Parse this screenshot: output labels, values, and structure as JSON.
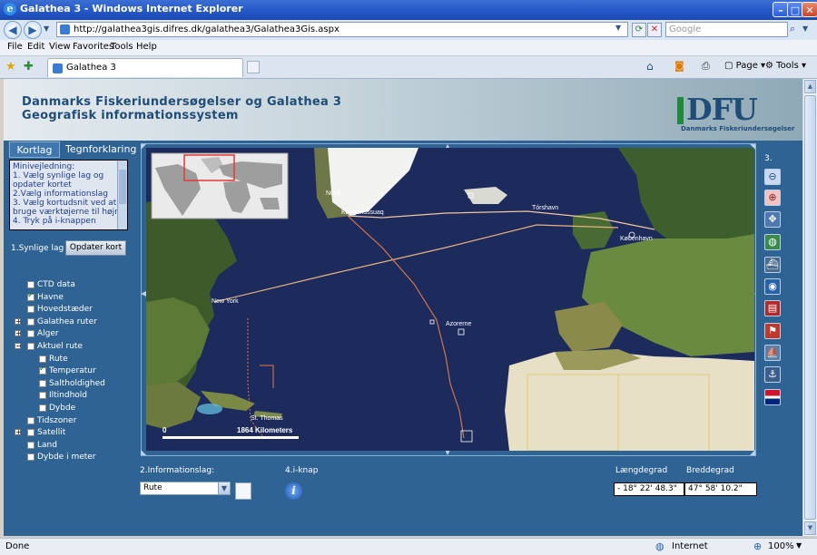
{
  "window": {
    "title": "Galathea 3 - Windows Internet Explorer",
    "controls": [
      "minimize-icon",
      "maximize-icon",
      "close-icon"
    ]
  },
  "address_bar": {
    "url": "http://galathea3gis.difres.dk/galathea3/Galathea3Gis.aspx",
    "search_placeholder": "Google"
  },
  "menu": [
    "File",
    "Edit",
    "View",
    "Favorites",
    "Tools",
    "Help"
  ],
  "tab": {
    "label": "Galathea 3"
  },
  "command_bar": {
    "page_label": "Page",
    "tools_label": "Tools"
  },
  "banner": {
    "line1": "Danmarks Fiskeriundersøgelser og Galathea 3",
    "line2": "Geografisk informationssystem",
    "logo_text": "DFU",
    "logo_sub": "Danmarks Fiskeriundersøgelser"
  },
  "panel": {
    "tabs": [
      "Kortlag",
      "Tegnforklaring"
    ],
    "help_lines": [
      "Minivejledning:",
      "1. Vælg synlige lag og",
      "opdater kortet",
      "2.Vælg informationslag",
      "3. Vælg kortudsnit ved at",
      "bruge værktøjerne til højre",
      "4. Tryk på i-knappen"
    ],
    "synlige_label": "1.Synlige lag",
    "update_button": "Opdater kort"
  },
  "layers": [
    {
      "label": "CTD data",
      "checked": false,
      "level": 0,
      "expander": ""
    },
    {
      "label": "Havne",
      "checked": true,
      "level": 0,
      "expander": ""
    },
    {
      "label": "Hovedstæder",
      "checked": false,
      "level": 0,
      "expander": ""
    },
    {
      "label": "Galathea ruter",
      "checked": false,
      "level": 0,
      "expander": "+"
    },
    {
      "label": "Alger",
      "checked": false,
      "level": 0,
      "expander": "+"
    },
    {
      "label": "Aktuel rute",
      "checked": false,
      "level": 0,
      "expander": "−"
    },
    {
      "label": "Rute",
      "checked": false,
      "level": 1,
      "expander": ""
    },
    {
      "label": "Temperatur",
      "checked": true,
      "level": 1,
      "expander": ""
    },
    {
      "label": "Saltholdighed",
      "checked": false,
      "level": 1,
      "expander": ""
    },
    {
      "label": "Iltindhold",
      "checked": false,
      "level": 1,
      "expander": ""
    },
    {
      "label": "Dybde",
      "checked": false,
      "level": 1,
      "expander": ""
    },
    {
      "label": "Tidszoner",
      "checked": false,
      "level": 0,
      "expander": ""
    },
    {
      "label": "Satellit",
      "checked": false,
      "level": 0,
      "expander": "+"
    },
    {
      "label": "Land",
      "checked": false,
      "level": 0,
      "expander": ""
    },
    {
      "label": "Dybde i meter",
      "checked": false,
      "level": 0,
      "expander": ""
    }
  ],
  "map": {
    "labels": {
      "nuuk": "Nuuk",
      "kangerlussuaq": "Kangerlussuaq",
      "torshavn": "Tórshavn",
      "kobenhavn": "København",
      "new_york": "New York",
      "azorerne": "Azorerne",
      "st_thomas": "St. Thomas"
    },
    "scale_zero": "0",
    "scale_label": "1864 Kilometers"
  },
  "toolbar": {
    "step_label": "3.",
    "tools": [
      "zoom-out-icon",
      "zoom-in-icon",
      "pan-icon",
      "full-extent-icon",
      "ship-icon",
      "globe-icon",
      "book-icon",
      "flag-icon",
      "boat-icon",
      "measure-icon",
      "union-jack-icon"
    ]
  },
  "bottom": {
    "info_label": "2.Informationslag:",
    "info_select": "Rute",
    "iknap_label": "4.i-knap",
    "lon_label": "Længdegrad",
    "lat_label": "Breddegrad",
    "lon_value": "- 18° 22' 48.3\"",
    "lat_value": "47° 58' 10.2\""
  },
  "status": {
    "left": "Done",
    "zone": "Internet",
    "zoom": "100%"
  }
}
